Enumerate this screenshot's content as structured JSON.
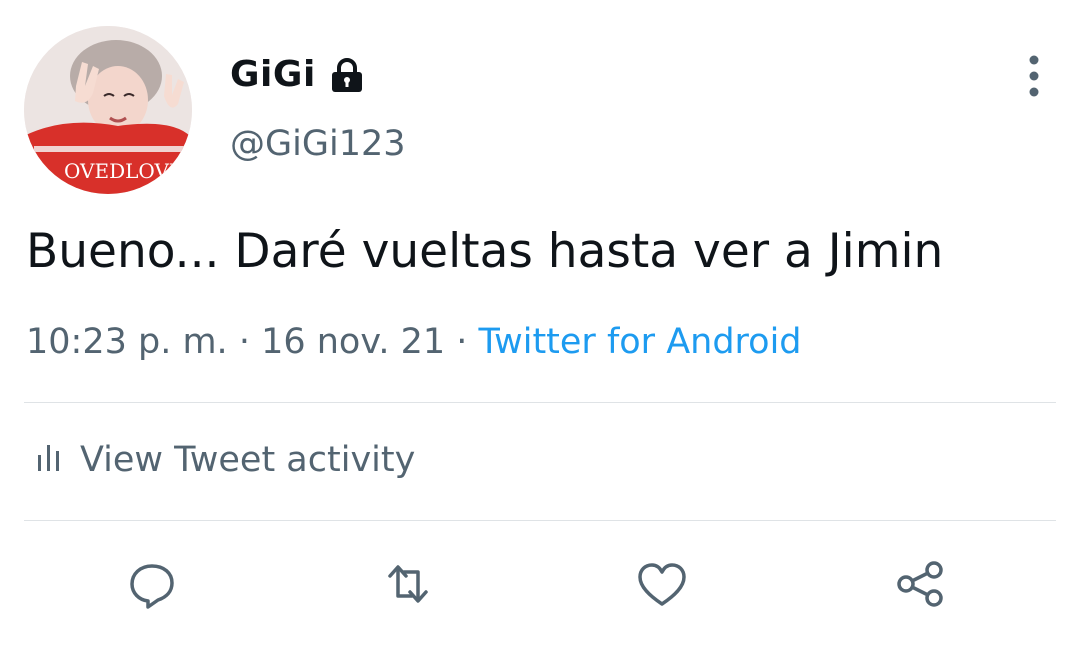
{
  "user": {
    "display_name": "GiGi",
    "handle": "@GiGi123",
    "avatar_text": "OVEDLOVE"
  },
  "tweet": {
    "text": "Bueno... Daré vueltas hasta ver a Jimin",
    "time": "10:23 p. m.",
    "separator": " · ",
    "date": "16 nov. 21",
    "source": "Twitter for Android"
  },
  "activity": {
    "label": "View Tweet activity"
  },
  "actions": [
    "reply-icon",
    "retweet-icon",
    "like-icon",
    "share-icon"
  ],
  "colors": {
    "text": "#0f1419",
    "secondary": "#536471",
    "link": "#1d9bf0",
    "divider": "#dfe3e6"
  }
}
